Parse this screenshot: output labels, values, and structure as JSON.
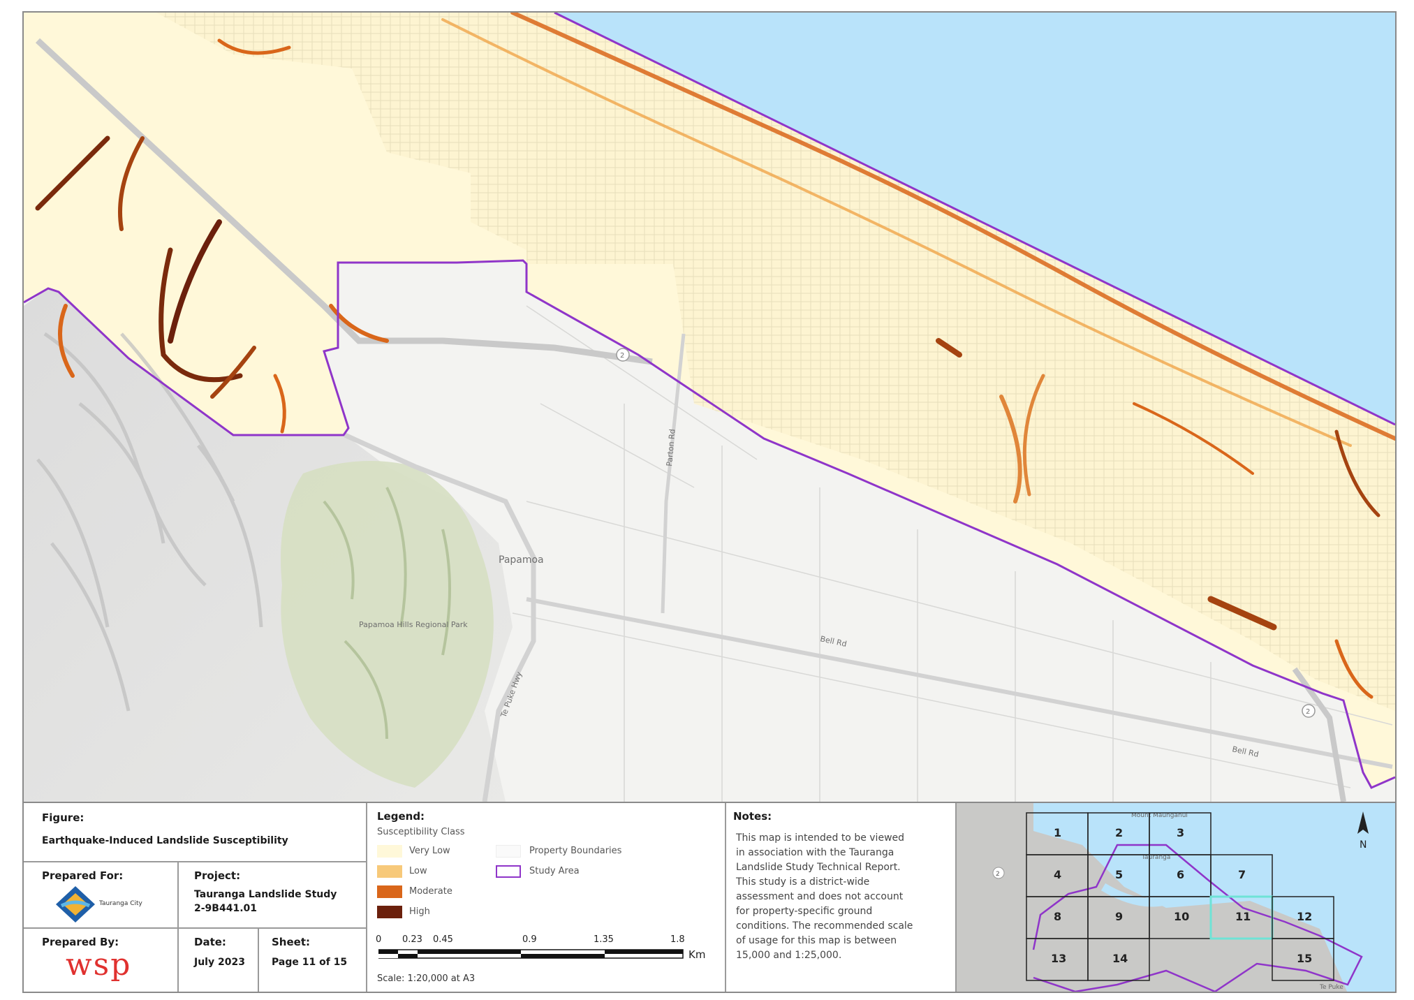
{
  "map": {
    "labels": {
      "place": "Papamoa",
      "park": "Papamoa Hills Regional Park",
      "road_te_puke": "Te Puke Hwy",
      "road_bell": "Bell Rd",
      "road_bell_2": "Bell Rd",
      "road_parton": "Parton Rd",
      "shield_2": "2",
      "shield_2b": "2"
    }
  },
  "title_block": {
    "figure_label": "Figure:",
    "figure_value": "Earthquake-Induced Landslide Susceptibility",
    "prepared_for_label": "Prepared For:",
    "client_name": "Tauranga City",
    "project_label": "Project:",
    "project_name": "Tauranga Landslide Study",
    "project_number": "2-9B441.01",
    "prepared_by_label": "Prepared By:",
    "consultant_logo": "wsp",
    "date_label": "Date:",
    "date_value": "July 2023",
    "sheet_label": "Sheet:",
    "sheet_value": "Page 11 of 15"
  },
  "legend": {
    "title": "Legend:",
    "subtitle": "Susceptibility Class",
    "classes": [
      {
        "label": "Very Low",
        "color": "#fff8d9"
      },
      {
        "label": "Low",
        "color": "#f7c97a"
      },
      {
        "label": "Moderate",
        "color": "#d9661a"
      },
      {
        "label": "High",
        "color": "#6b200c"
      }
    ],
    "property_label": "Property Boundaries",
    "study_label": "Study Area",
    "study_color": "#8f35c9"
  },
  "scale": {
    "ticks": [
      "0",
      "0.23",
      "0.45",
      "0.9",
      "1.35",
      "1.8"
    ],
    "unit": "Km",
    "text": "Scale: 1:20,000 at A3"
  },
  "notes": {
    "title": "Notes:",
    "lines": [
      "This map is intended to be viewed",
      "in association with the Tauranga",
      "Landslide Study Technical Report.",
      "This study is a district-wide",
      "assessment and does not account",
      "for property-specific ground",
      "conditions. The recommended scale",
      "of usage for this map is between",
      "15,000 and 1:25,000."
    ]
  },
  "inset": {
    "sheets": [
      "1",
      "2",
      "3",
      "4",
      "5",
      "6",
      "7",
      "8",
      "9",
      "10",
      "11",
      "12",
      "13",
      "14",
      "15"
    ],
    "current_sheet": "11",
    "north": "N",
    "place_1": "Mount Maunganui",
    "place_2": "Tauranga",
    "place_3": "Te Puke",
    "shield": "2"
  }
}
